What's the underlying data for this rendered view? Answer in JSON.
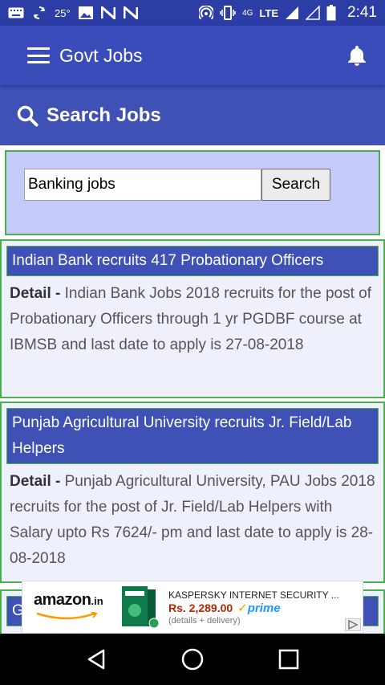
{
  "status_bar": {
    "temperature": "25°",
    "network": "4G",
    "lte": "LTE",
    "time": "2:41",
    "icons": [
      "keyboard-icon",
      "sync-icon",
      "image-icon",
      "n-icon",
      "n-icon",
      "hotspot-icon",
      "vibrate-icon",
      "signal-icon",
      "signal-icon",
      "battery-icon"
    ]
  },
  "app_bar": {
    "title": "Govt Jobs",
    "menu_icon": "menu-icon",
    "notification_icon": "bell-icon"
  },
  "search_header": {
    "title": "Search Jobs",
    "icon": "search-icon"
  },
  "search": {
    "value": "Banking jobs",
    "button_label": "Search"
  },
  "jobs": [
    {
      "title": "Indian Bank recruits 417 Probationary Officers",
      "detail_label": "Detail -",
      "detail": " Indian Bank Jobs 2018 recruits for the post of Probationary Officers through 1 yr PGDBF course at IBMSB and last date to apply is 27-08-2018"
    },
    {
      "title": "Punjab Agricultural University recruits Jr. Field/Lab Helpers",
      "detail_label": "Detail -",
      "detail": " Punjab Agricultural University, PAU Jobs 2018 recruits for the post of Jr. Field/Lab Helpers with Salary upto Rs 7624/- pm and last date to apply is 28-08-2018"
    },
    {
      "title": "G"
    }
  ],
  "ad": {
    "brand": "amazon",
    "brand_suffix": ".in",
    "product_name": "KASPERSKY INTERNET SECURITY ...",
    "price": "Rs. 2,289.00",
    "prime_label": "prime",
    "delivery_note": "(details + delivery)"
  },
  "nav_bar": {
    "icons": [
      "back-icon",
      "home-icon",
      "recents-icon"
    ]
  },
  "colors": {
    "status_bar": "#2d3da6",
    "app_bar": "#3a4cba",
    "header": "#3f51b5",
    "panel": "#c5cbf8",
    "card_bg": "#eef0fb",
    "border": "#4caf50"
  }
}
